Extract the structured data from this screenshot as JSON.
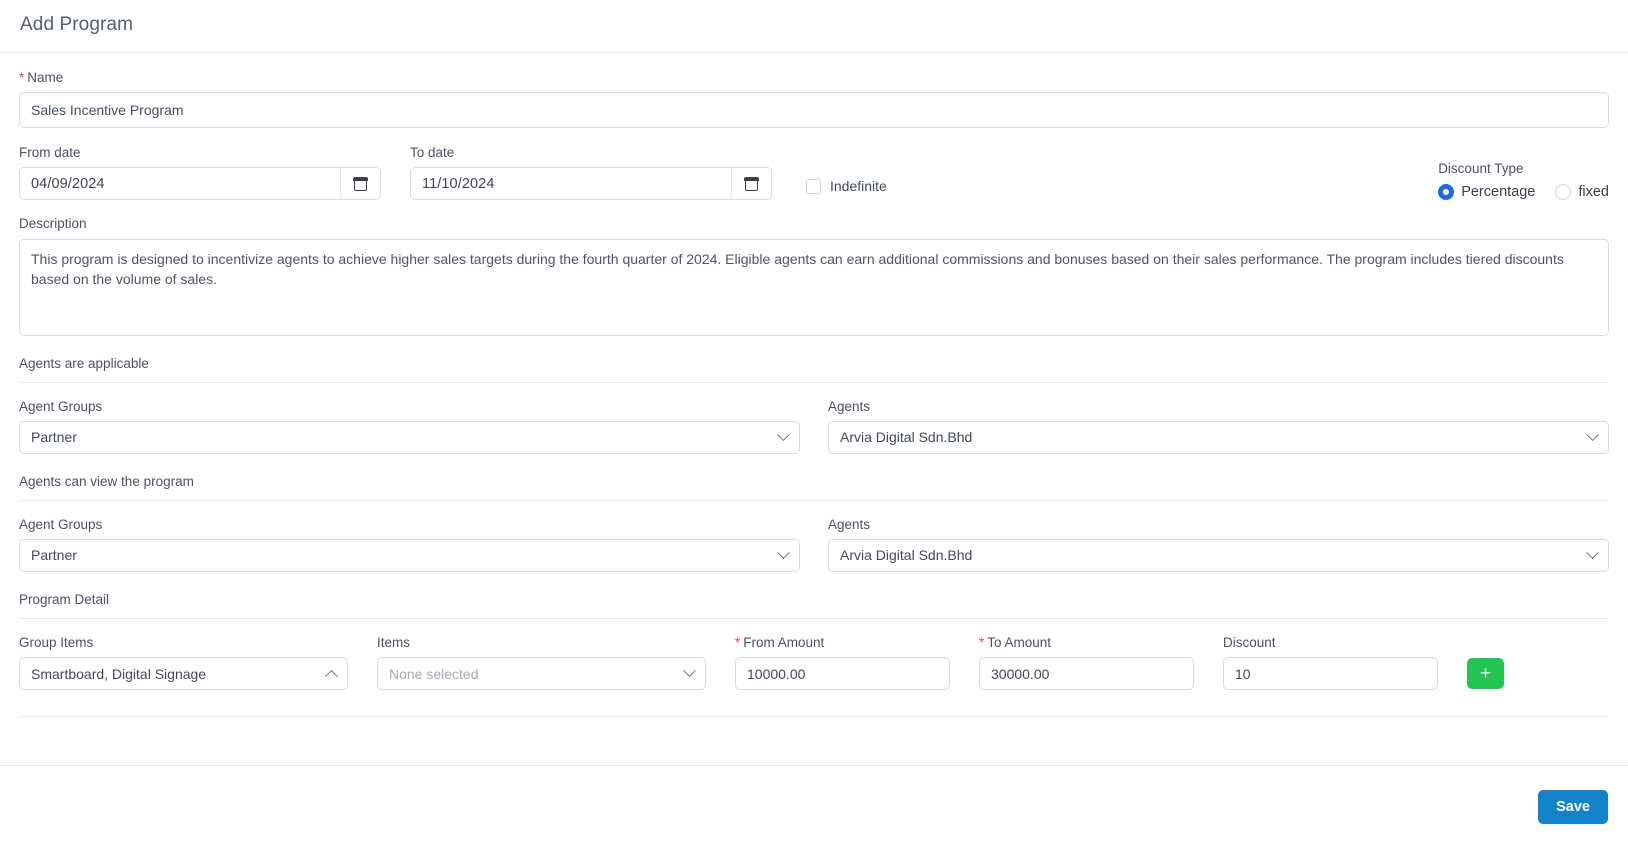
{
  "header": {
    "title": "Add Program"
  },
  "name_field": {
    "label": "Name",
    "required_mark": "*",
    "value": "Sales Incentive Program"
  },
  "from_date": {
    "label": "From date",
    "value": "04/09/2024",
    "icon": "calendar-icon"
  },
  "to_date": {
    "label": "To date",
    "value": "11/10/2024",
    "icon": "calendar-icon"
  },
  "indefinite": {
    "label": "Indefinite",
    "checked": false
  },
  "discount_type": {
    "label": "Discount Type",
    "options": [
      {
        "label": "Percentage",
        "selected": true
      },
      {
        "label": "fixed",
        "selected": false
      }
    ],
    "accent": "#1d6ae5"
  },
  "description": {
    "label": "Description",
    "value": "This program is designed to incentivize agents to achieve higher sales targets during the fourth quarter of 2024. Eligible agents can earn additional commissions and bonuses based on their sales performance. The program includes tiered discounts based on the volume of sales."
  },
  "applicable_section": {
    "caption": "Agents are applicable",
    "agent_groups": {
      "label": "Agent Groups",
      "value": "Partner"
    },
    "agents": {
      "label": "Agents",
      "value": "Arvia Digital Sdn.Bhd"
    }
  },
  "view_section": {
    "caption": "Agents can view the program",
    "agent_groups": {
      "label": "Agent Groups",
      "value": "Partner"
    },
    "agents": {
      "label": "Agents",
      "value": "Arvia Digital Sdn.Bhd"
    }
  },
  "program_detail": {
    "caption": "Program Detail",
    "group_items": {
      "label": "Group Items",
      "value": "Smartboard, Digital Signage",
      "chevron": "chevron-up-icon"
    },
    "items": {
      "label": "Items",
      "placeholder": "None selected",
      "value": "",
      "chevron": "chevron-down-icon"
    },
    "from_amount": {
      "label": "From Amount",
      "required_mark": "*",
      "value": "10000.00"
    },
    "to_amount": {
      "label": "To Amount",
      "required_mark": "*",
      "value": "30000.00"
    },
    "discount": {
      "label": "Discount",
      "value": "10"
    },
    "add_button": {
      "label": "+",
      "color": "#23c552"
    }
  },
  "footer": {
    "save_label": "Save",
    "save_color": "#1283c9"
  }
}
